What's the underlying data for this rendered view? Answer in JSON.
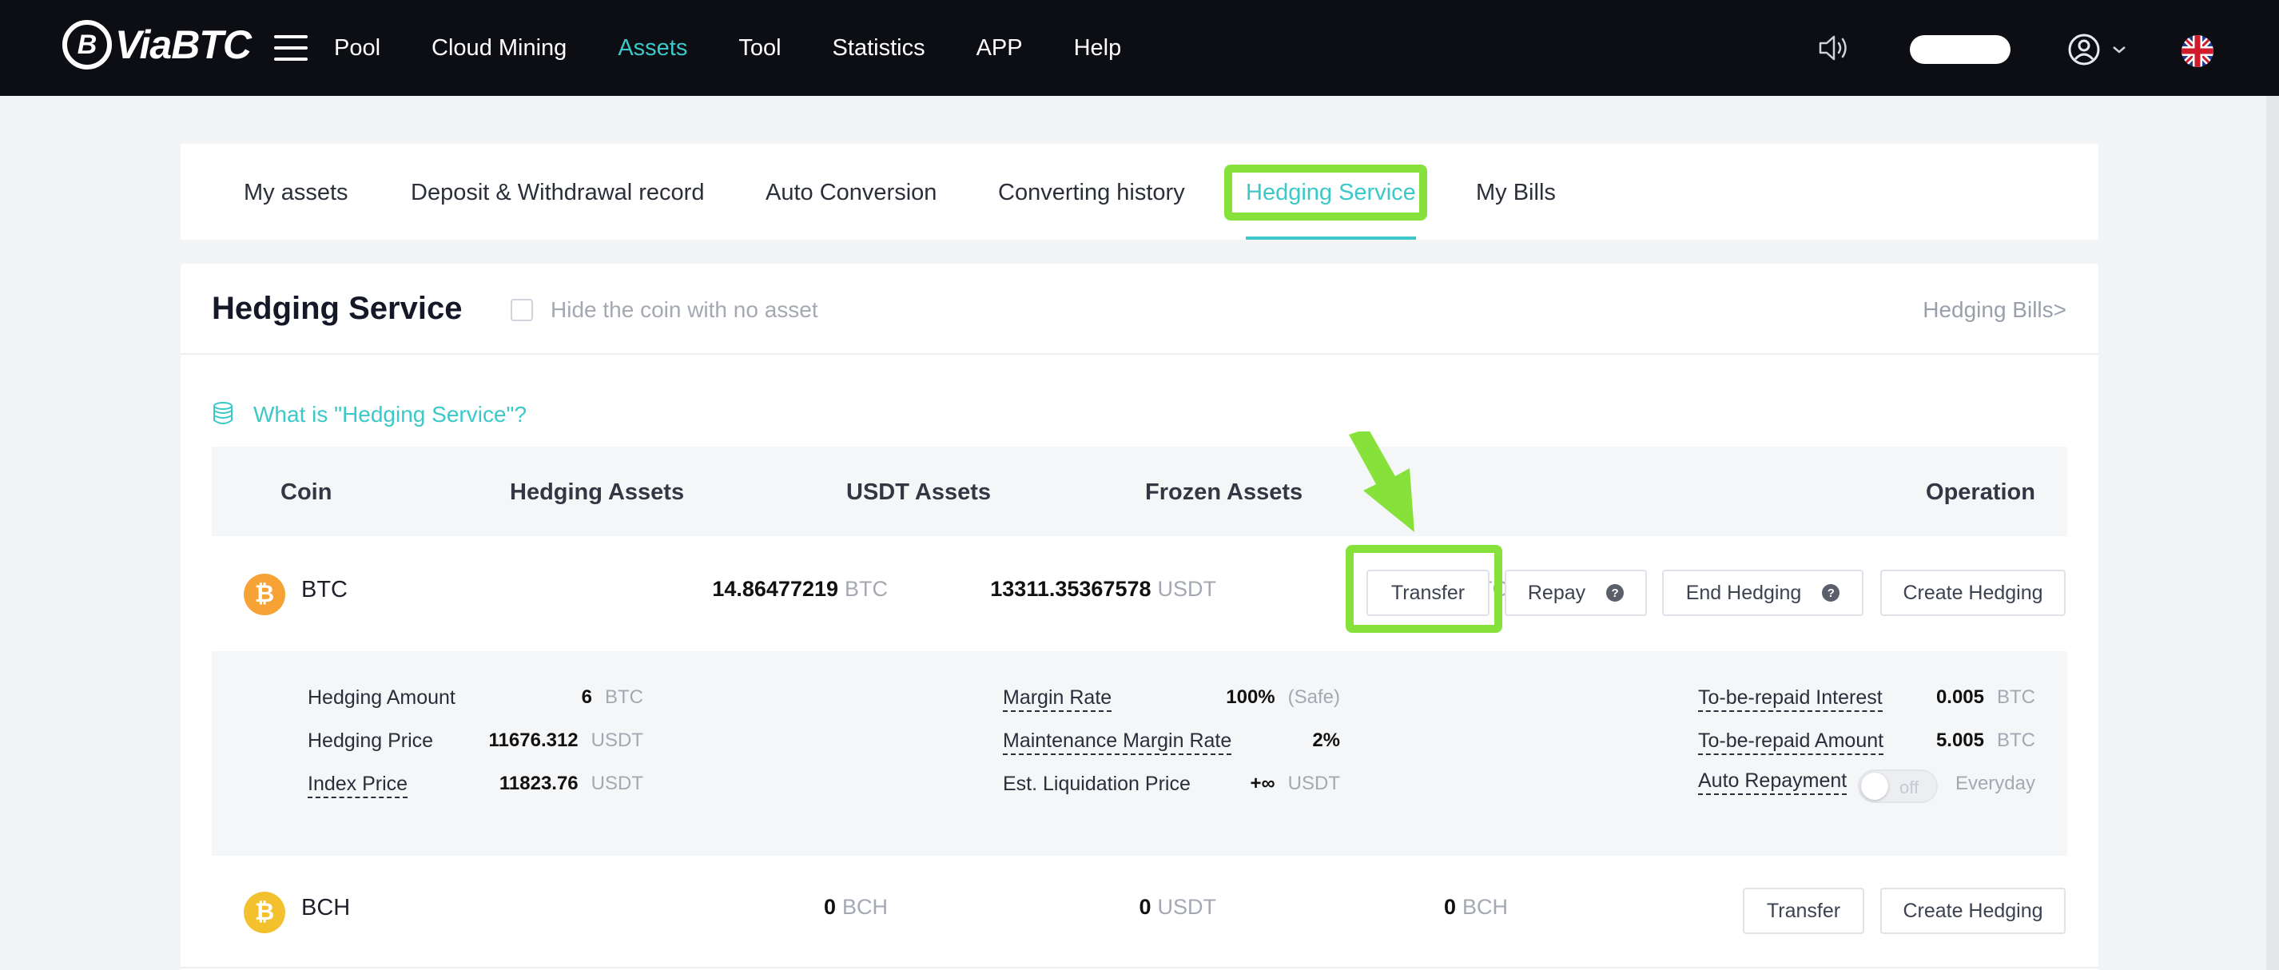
{
  "brand": {
    "logo_text": "ViaBTC",
    "logo_mark": "B"
  },
  "nav": {
    "items": [
      {
        "label": "Pool",
        "active": false
      },
      {
        "label": "Cloud Mining",
        "active": false
      },
      {
        "label": "Assets",
        "active": true
      },
      {
        "label": "Tool",
        "active": false
      },
      {
        "label": "Statistics",
        "active": false
      },
      {
        "label": "APP",
        "active": false
      },
      {
        "label": "Help",
        "active": false
      }
    ]
  },
  "tabs": [
    {
      "label": "My assets"
    },
    {
      "label": "Deposit & Withdrawal record"
    },
    {
      "label": "Auto Conversion"
    },
    {
      "label": "Converting history"
    },
    {
      "label": "Hedging Service",
      "active": true
    },
    {
      "label": "My Bills"
    }
  ],
  "header": {
    "title": "Hedging Service",
    "hide_label": "Hide the coin with no asset",
    "bills_link": "Hedging Bills>"
  },
  "what_is_label": "What is \"Hedging Service\"?",
  "table": {
    "columns": {
      "coin": "Coin",
      "hedging": "Hedging Assets",
      "usdt": "USDT Assets",
      "frozen": "Frozen Assets",
      "operation": "Operation"
    },
    "rows": [
      {
        "coin": "BTC",
        "icon_symbol": "₿",
        "icon_color": "#f7a234",
        "hedging_value": "14.86477219",
        "hedging_unit": "BTC",
        "usdt_value": "13311.35367578",
        "usdt_unit": "USDT",
        "frozen_value": "0",
        "frozen_unit": "BTC",
        "buttons": {
          "transfer": "Transfer",
          "repay": "Repay",
          "end": "End Hedging",
          "create": "Create Hedging"
        }
      },
      {
        "coin": "BCH",
        "icon_symbol": "₿",
        "icon_color": "#f4c12e",
        "hedging_value": "0",
        "hedging_unit": "BCH",
        "usdt_value": "0",
        "usdt_unit": "USDT",
        "frozen_value": "0",
        "frozen_unit": "BCH",
        "buttons": {
          "transfer": "Transfer",
          "create": "Create Hedging"
        }
      }
    ]
  },
  "details": {
    "hedging_amount": {
      "label": "Hedging Amount",
      "value": "6",
      "unit": "BTC"
    },
    "hedging_price": {
      "label": "Hedging Price",
      "value": "11676.312",
      "unit": "USDT"
    },
    "index_price": {
      "label": "Index Price",
      "value": "11823.76",
      "unit": "USDT"
    },
    "margin_rate": {
      "label": "Margin Rate",
      "value": "100%",
      "unit": "(Safe)"
    },
    "maintenance_margin_rate": {
      "label": "Maintenance Margin Rate",
      "value": "2%"
    },
    "est_liquidation_price": {
      "label": "Est. Liquidation Price",
      "value": "+∞",
      "unit": "USDT"
    },
    "to_be_repaid_interest": {
      "label": "To-be-repaid Interest",
      "value": "0.005",
      "unit": "BTC"
    },
    "to_be_repaid_amount": {
      "label": "To-be-repaid Amount",
      "value": "5.005",
      "unit": "BTC"
    },
    "auto_repayment": {
      "label": "Auto Repayment",
      "toggle_text": "off",
      "frequency": "Everyday"
    }
  },
  "colors": {
    "accent": "#3cc8c8",
    "annotation": "#86e23a",
    "topbar": "#0c0e14"
  },
  "icons": [
    "menu-icon",
    "speaker-icon",
    "user-icon",
    "chevron-down-icon",
    "uk-flag-icon",
    "coins-stack-icon",
    "help-icon"
  ]
}
